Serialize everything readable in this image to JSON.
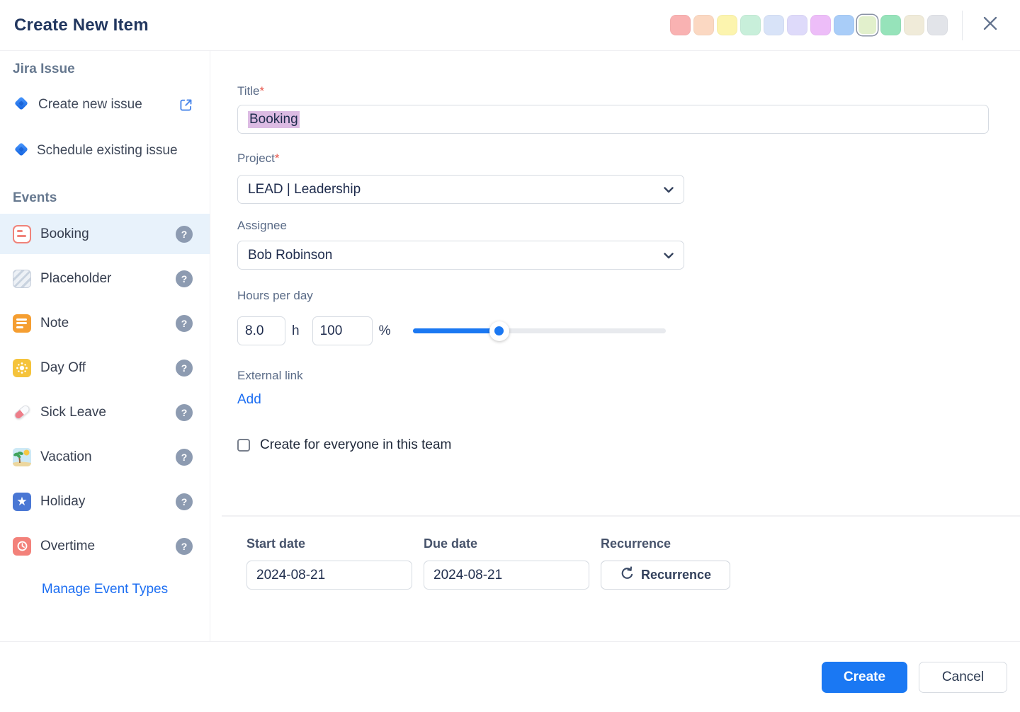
{
  "header": {
    "title": "Create New Item",
    "swatches": [
      "#f9b2b2",
      "#fbd8c2",
      "#fcf4ae",
      "#c8efda",
      "#d8e3f8",
      "#dedafa",
      "#edbdf8",
      "#a9cdf8",
      "#e2f0cc",
      "#96e3ba",
      "#f0ebd9",
      "#e2e4e9"
    ],
    "selected_swatch_index": 8
  },
  "sidebar": {
    "jira_section_title": "Jira Issue",
    "jira_items": [
      {
        "label": "Create new issue"
      },
      {
        "label": "Schedule existing issue"
      }
    ],
    "events_section_title": "Events",
    "events": [
      {
        "label": "Booking",
        "selected": true
      },
      {
        "label": "Placeholder",
        "selected": false
      },
      {
        "label": "Note",
        "selected": false
      },
      {
        "label": "Day Off",
        "selected": false
      },
      {
        "label": "Sick Leave",
        "selected": false
      },
      {
        "label": "Vacation",
        "selected": false
      },
      {
        "label": "Holiday",
        "selected": false
      },
      {
        "label": "Overtime",
        "selected": false
      }
    ],
    "manage_link": "Manage Event Types"
  },
  "form": {
    "title_label": "Title",
    "required_marker": "*",
    "title_value": "Booking",
    "project_label": "Project",
    "project_value": "LEAD | Leadership",
    "assignee_label": "Assignee",
    "assignee_value": "Bob Robinson",
    "hours_label": "Hours per day",
    "hours_value": "8.0",
    "hours_unit": "h",
    "percent_value": "100",
    "percent_unit": "%",
    "slider_percent": 34,
    "external_link_label": "External link",
    "add_link_label": "Add",
    "checkbox_label": "Create for everyone in this team",
    "checkbox_checked": false
  },
  "schedule": {
    "start_label": "Start date",
    "start_value": "2024-08-21",
    "due_label": "Due date",
    "due_value": "2024-08-21",
    "recurrence_label": "Recurrence",
    "recurrence_button_label": "Recurrence"
  },
  "footer": {
    "create_label": "Create",
    "cancel_label": "Cancel"
  },
  "colors": {
    "accent_blue": "#1a78f3",
    "link_blue": "#1c6ef2",
    "text_selection": "#dcbbe3",
    "selected_event_bg": "#e8f2fb"
  }
}
